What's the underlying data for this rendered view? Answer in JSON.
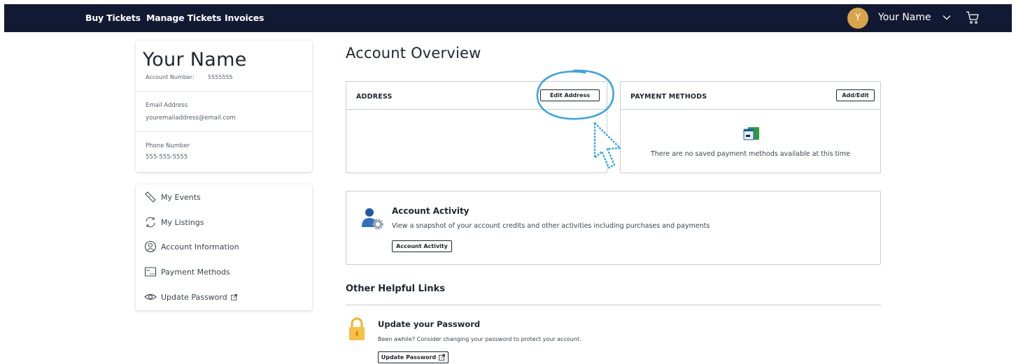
{
  "nav": {
    "links": [
      "Buy Tickets",
      "Manage Tickets",
      "Invoices"
    ],
    "avatar_initial": "Y",
    "user_name": "Your Name",
    "bar_color": "#121a33",
    "avatar_color": "#d7a44a"
  },
  "profile": {
    "name": "Your Name",
    "account_number_label": "Account Number:",
    "account_number": "5555555",
    "email_label": "Email Address",
    "email": "youremailaddress@email.com",
    "phone_label": "Phone Number",
    "phone": "555-555-5555"
  },
  "menu": {
    "items": [
      {
        "label": "My Events",
        "icon": "ticket-icon"
      },
      {
        "label": "My Listings",
        "icon": "refresh-icon"
      },
      {
        "label": "Account Information",
        "icon": "user-circle-icon"
      },
      {
        "label": "Payment Methods",
        "icon": "card-icon"
      },
      {
        "label": "Update Password",
        "icon": "eye-icon"
      }
    ]
  },
  "main": {
    "title": "Account Overview",
    "address": {
      "title": "ADDRESS",
      "button": "Edit Address"
    },
    "payment": {
      "title": "PAYMENT METHODS",
      "button": "Add/Edit",
      "empty_text": "There are no saved payment methods available at this time"
    },
    "activity": {
      "title": "Account Activity",
      "description": "View a snapshot of your account credits and other activities including purchases and payments",
      "button": "Account Activity"
    },
    "helpful": {
      "title": "Other Helpful Links",
      "password_title": "Update your Password",
      "password_desc": "Been awhile? Consider changing your password to protect your account.",
      "password_button": "Update Password"
    }
  },
  "annotation": {
    "highlight_color": "#3aa5e0"
  }
}
